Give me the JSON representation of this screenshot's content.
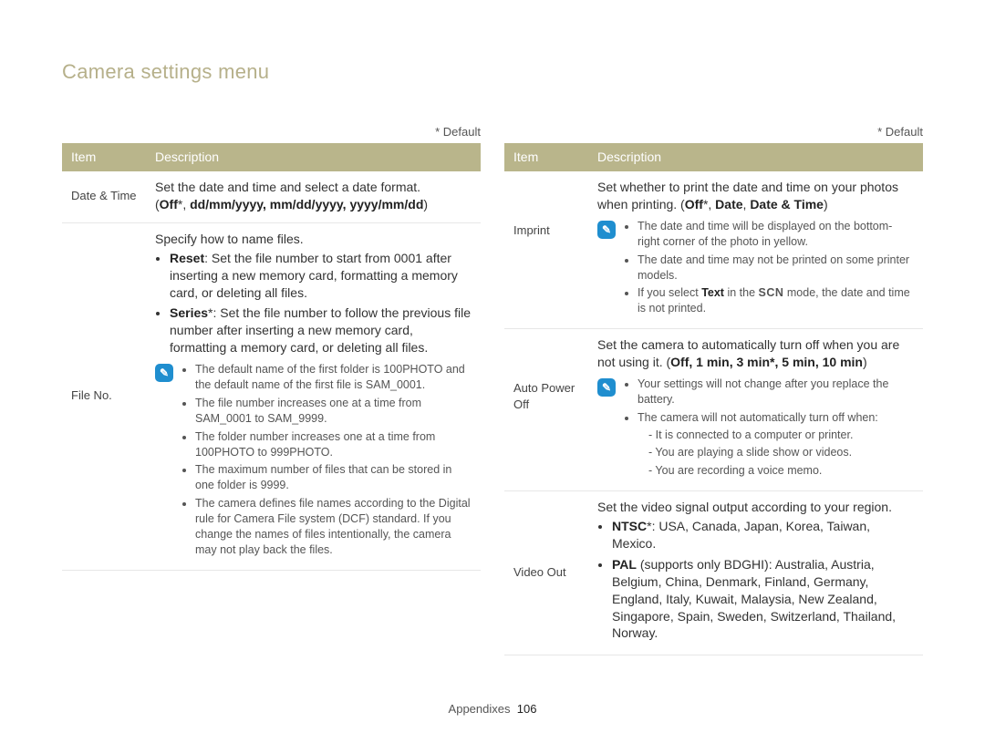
{
  "title": "Camera settings menu",
  "default_note": "* Default",
  "headers": {
    "item": "Item",
    "desc": "Description"
  },
  "footer": {
    "section": "Appendixes",
    "page": "106"
  },
  "left": {
    "r0": {
      "item": "Date & Time",
      "p1": "Set the date and time and select a date format.",
      "fmt_open": "(",
      "fmt_off": "Off",
      "fmt_star": "*,",
      "fmt_rest": "dd/mm/yyyy, mm/dd/yyyy, yyyy/mm/dd",
      "fmt_close": ")"
    },
    "r1": {
      "item": "File No.",
      "intro": "Specify how to name files.",
      "reset_label": "Reset",
      "reset_text": ": Set the file number to start from 0001 after inserting a new memory card, formatting a memory card, or deleting all files.",
      "series_label": "Series",
      "series_star": "*",
      "series_text": ": Set the file number to follow the previous file number after inserting a new memory card, formatting a memory card, or deleting all files.",
      "n0": "The default name of the first folder is 100PHOTO and the default name of the first file is SAM_0001.",
      "n1": "The file number increases one at a time from SAM_0001 to SAM_9999.",
      "n2": "The folder number increases one at a time from 100PHOTO to 999PHOTO.",
      "n3": "The maximum number of files that can be stored in one folder is 9999.",
      "n4": "The camera defines file names according to the Digital rule for Camera File system (DCF) standard. If you change the names of files intentionally, the camera may not play back the files."
    }
  },
  "right": {
    "r0": {
      "item": "Imprint",
      "p1": "Set whether to print the date and time on your photos when printing. (",
      "off": "Off",
      "star": "*,",
      "opt1": "Date",
      "comma": ",",
      "opt2": "Date & Time",
      "close": ")",
      "n0": "The date and time will be displayed on the bottom-right corner of the photo in yellow.",
      "n1": "The date and time may not be printed on some printer models.",
      "n2a": "If you select ",
      "n2b": "Text",
      "n2c": " in the ",
      "n2d": "SCN",
      "n2e": " mode, the date and time is not printed."
    },
    "r1": {
      "item": "Auto Power Off",
      "p1": "Set the camera to automatically turn off when you are not using it. (",
      "opts": "Off, 1 min, 3 min*, 5 min, 10 min",
      "close": ")",
      "n0": "Your settings will not change after you replace the battery.",
      "n1": "The camera will not automatically turn off when:",
      "d0": "It is connected to a computer or printer.",
      "d1": "You are playing a slide show or videos.",
      "d2": "You are recording a voice memo."
    },
    "r2": {
      "item": "Video Out",
      "p1": "Set the video signal output according to your region.",
      "ntsc_label": "NTSC",
      "ntsc_star": "*",
      "ntsc_text": ": USA, Canada, Japan, Korea, Taiwan, Mexico.",
      "pal_label": "PAL",
      "pal_paren": " (supports only BDGHI)",
      "pal_text": ": Australia, Austria, Belgium, China, Denmark, Finland, Germany, England, Italy, Kuwait, Malaysia, New Zealand, Singapore, Spain, Sweden, Switzerland, Thailand, Norway."
    }
  }
}
